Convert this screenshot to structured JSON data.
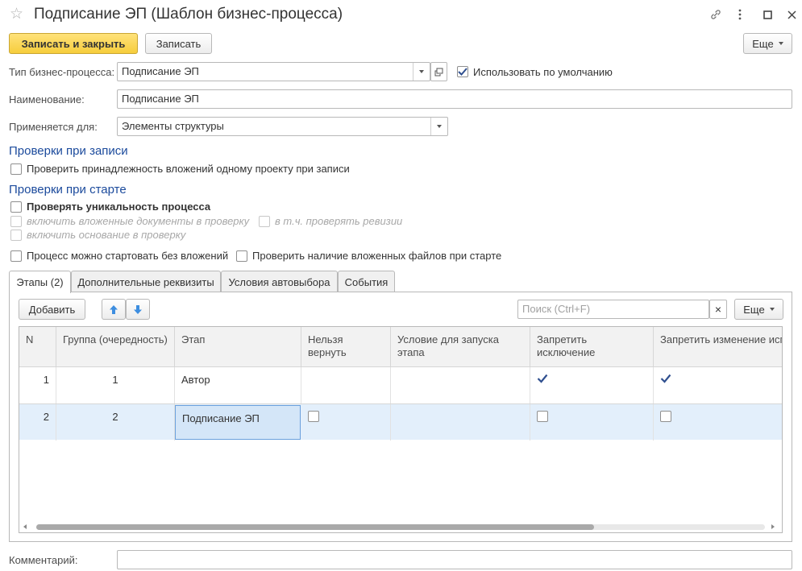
{
  "window": {
    "title": "Подписание ЭП (Шаблон бизнес-процесса)"
  },
  "toolbar": {
    "save_close_label": "Записать и закрыть",
    "save_label": "Записать",
    "more_label": "Еще"
  },
  "form": {
    "process_type_label": "Тип бизнес-процесса:",
    "process_type_value": "Подписание ЭП",
    "use_default_label": "Использовать по умолчанию",
    "use_default_checked": true,
    "name_label": "Наименование:",
    "name_value": "Подписание ЭП",
    "applies_label": "Применяется для:",
    "applies_value": "Элементы структуры",
    "comment_label": "Комментарий:",
    "comment_value": ""
  },
  "checks_on_save": {
    "title": "Проверки при записи",
    "check_attachments_label": "Проверить принадлежность вложений одному проекту при записи"
  },
  "checks_on_start": {
    "title": "Проверки при старте",
    "check_unique_label": "Проверять уникальность процесса",
    "include_docs_label": "включить вложенные документы в проверку",
    "check_revisions_label": "в т.ч. проверять ревизии",
    "include_basis_label": "включить основание в проверку",
    "start_without_attach_label": "Процесс можно стартовать без вложений",
    "check_files_label": "Проверить наличие вложенных файлов при старте"
  },
  "tabs": [
    {
      "label": "Этапы (2)",
      "active": true
    },
    {
      "label": "Дополнительные реквизиты",
      "active": false
    },
    {
      "label": "Условия автовыбора",
      "active": false
    },
    {
      "label": "События",
      "active": false
    }
  ],
  "stages": {
    "add_label": "Добавить",
    "search_placeholder": "Поиск (Ctrl+F)",
    "clear_label": "×",
    "more_label": "Еще",
    "columns": [
      "N",
      "Группа (очередность)",
      "Этап",
      "Нельзя вернуть",
      "Условие для запуска этапа",
      "Запретить исключение",
      "Запретить изменение исполнителей"
    ],
    "rows": [
      {
        "n": "1",
        "group": "1",
        "stage": "Автор",
        "no_return": null,
        "condition": "",
        "forbid_exclude": true,
        "forbid_change": true
      },
      {
        "n": "2",
        "group": "2",
        "stage": "Подписание ЭП",
        "no_return": false,
        "condition": "",
        "forbid_exclude": false,
        "forbid_change": false
      }
    ],
    "selected_row": 2
  },
  "colors": {
    "accent_yellow": "#f6cd3c",
    "section_blue": "#1b4a9c",
    "selected_row": "#e3effb",
    "selected_cell_border": "#6aa0dc",
    "arrow_blue": "#3d8ee0"
  },
  "icons": [
    "star-icon",
    "link-icon",
    "more-vertical-icon",
    "maximize-icon",
    "close-icon",
    "open-icon",
    "arrow-up-icon",
    "arrow-down-icon",
    "check-icon"
  ]
}
